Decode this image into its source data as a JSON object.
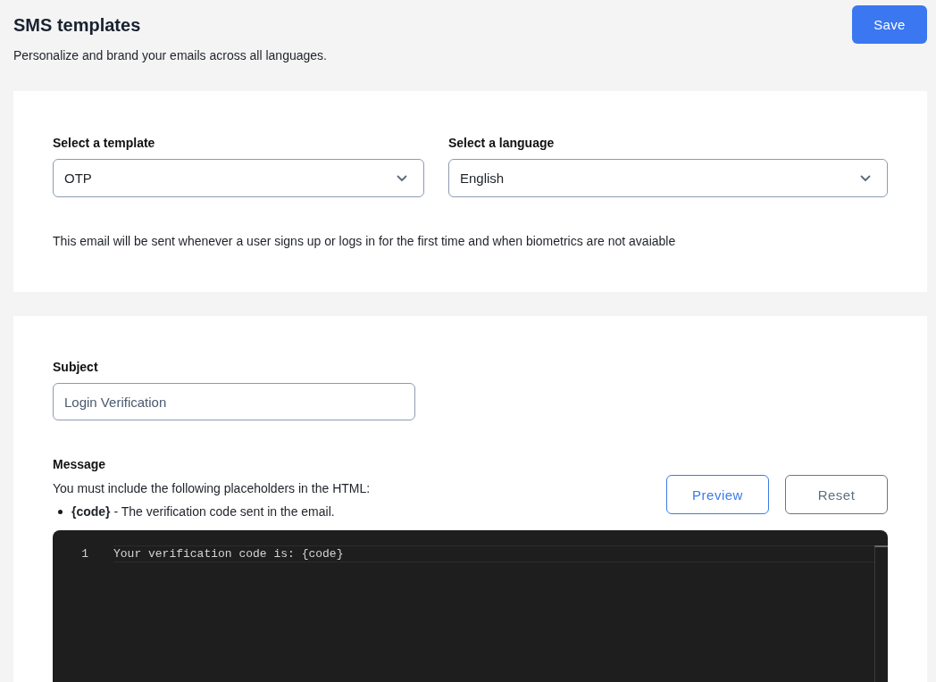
{
  "header": {
    "title": "SMS templates",
    "subtitle": "Personalize and brand your emails across all languages.",
    "save_button": "Save"
  },
  "template_card": {
    "selects": [
      {
        "label": "Select a template",
        "value": "OTP"
      },
      {
        "label": "Select a language",
        "value": "English"
      }
    ],
    "description": "This email will be sent whenever a user signs up or logs in for the first time and when biometrics are not avaiable"
  },
  "content_card": {
    "subject": {
      "label": "Subject",
      "value": "Login Verification"
    },
    "message": {
      "label": "Message",
      "instructions": "You must include the following placeholders in the HTML:",
      "placeholders": [
        "**{code}** - The verification code sent in the email."
      ],
      "buttons": [
        {
          "label": "Preview",
          "kind": "primary"
        },
        {
          "label": "Reset",
          "kind": "secondary"
        }
      ],
      "editor": {
        "lines": [
          {
            "number": "1",
            "text": "Your verification code is: {code}",
            "active": true
          }
        ]
      }
    }
  }
}
